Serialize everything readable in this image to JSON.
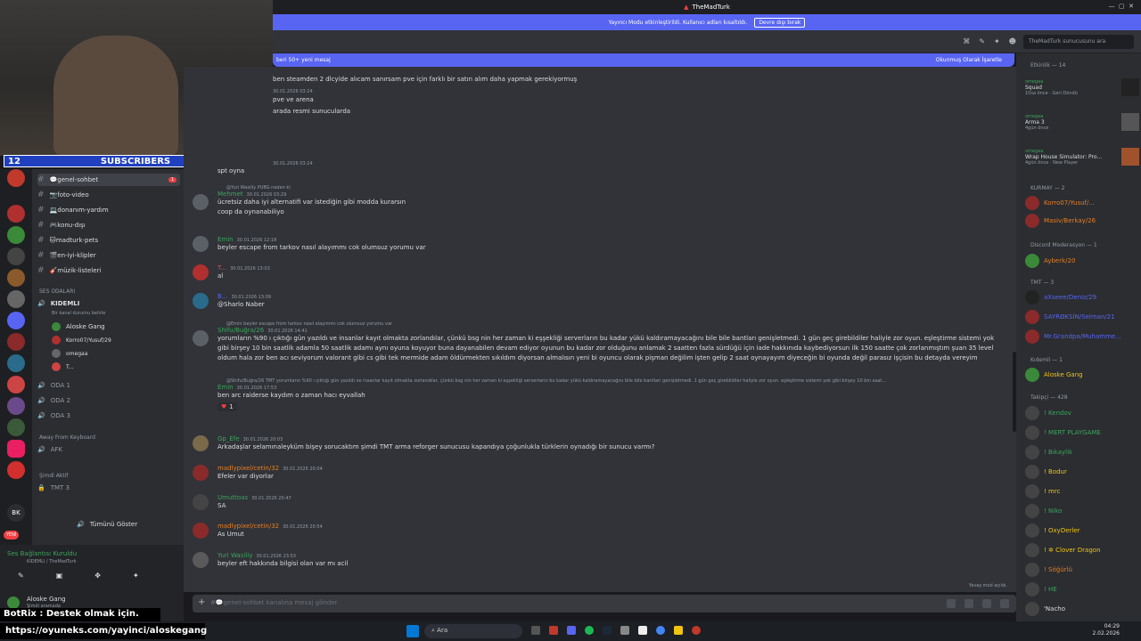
{
  "title": "TheMadTurk",
  "streamer_banner": {
    "text": "Yayıncı Modu etkinleştirildi. Kullanıcı adları kısaltıldı.",
    "button": "Devre dışı bırak"
  },
  "header": {
    "search_placeholder": "TheMadTurk sunucusunu ara"
  },
  "new_messages": {
    "left": "beri 50+ yeni mesaj",
    "right": "Okunmuş Olarak İşaretle"
  },
  "subs": {
    "left": "12",
    "center": "SUBSCRIBERS",
    "right": "10"
  },
  "channels": [
    {
      "name": "💬genel-sohbet",
      "badge": "1"
    },
    {
      "name": "📷foto-video"
    },
    {
      "name": "💻donanım-yardım"
    },
    {
      "name": "🎮konu-dışı"
    },
    {
      "name": "🐱madturk-pets"
    },
    {
      "name": "🎬en-iyi-klipler"
    },
    {
      "name": "🎸müzik-listeleri"
    }
  ],
  "voice_section": "SES ODALARI",
  "voice_channels": [
    {
      "name": "KIDEMLI",
      "sub": "Bir kanal durumu belirle"
    },
    {
      "name": "ODA 1"
    },
    {
      "name": "ODA 2"
    },
    {
      "name": "ODA 3"
    }
  ],
  "voice_users": [
    "Aloske Gang",
    "Korro07/Yusuf/29",
    "omegaa",
    "T..."
  ],
  "away_section": "Away From Keyboard",
  "afk": "AFK",
  "now_active": "Şimdi Aktif",
  "tmt3": "TMT 3",
  "show_all": "Tümünü Göster",
  "new_label": "YENİ",
  "connection": {
    "title": "Ses Bağlantısı Kuruldu",
    "sub": "KIDEMLI / TheMadTurk"
  },
  "user": {
    "name": "Aloske Gang",
    "status": "Şimdi aramada"
  },
  "messages": [
    {
      "author": "",
      "time": "",
      "text": "ben steamden 2 dlcyide alıcam sanırsam pve için farklı bir satın alım daha yapmak gerekiyormuş"
    },
    {
      "author": "",
      "time": "30.01.2026 03:24",
      "text": "pve ve arena"
    },
    {
      "author": "",
      "time": "",
      "text": "arada resmi sunucularda"
    },
    {
      "author": "",
      "time": "30.01.2026 03:24",
      "text": "spt oyna"
    },
    {
      "author": "Mehmet",
      "color": "#3ba55c",
      "time": "30.01.2026 03:29",
      "reply": "@Yuri Wasiliy  PUBG  neden ki",
      "text": "ücretsiz daha iyi alternatifi var istediğin gibi modda kurarsın\ncoop da oynanabiliyo"
    },
    {
      "author": "Emin",
      "color": "#3ba55c",
      "time": "30.01.2026 12:18",
      "text": "beyler escape from tarkov nasıl alayımmı cok olumsuz yorumu var"
    },
    {
      "author": "T...",
      "color": "#f04747",
      "time": "30.01.2026 13:03",
      "text": "al"
    },
    {
      "author": "B...",
      "color": "#5865f2",
      "time": "30.01.2026 13:09",
      "text": "@Sharlo Naber"
    },
    {
      "author": "Shifu/Buğra/26",
      "color": "#3ba55c",
      "time": "30.01.2026 14:41",
      "reply": "@Emin beyler escape from tarkov nasıl alayımmı cok olumsuz yorumu var",
      "text": "yorumların %90 ı çıktığı gün yazıldı ve insanlar kayıt olmakta zorlandılar, çünkü bsg nin her zaman ki eşşekliği serverların bu kadar yükü kaldıramayacağını bile bile bantları genişletmedi. 1 gün geç girebildiler haliyle zor oyun. eşleştirme sistemi yok gibi birşey 10 bin saatlik adamla 50 saatlik adamı aynı oyuna koyuyor buna dayanabilen devam ediyor oyunun bu kadar zor olduğunu anlamak 2 saatten fazla sürdüğü için iade hakkınıda kaybediyorsun ilk 150 saatte çok zorlanmıştım şuan 35 level oldum hala zor ben acı seviyorum valorant gibi cs gibi tek mermide adam öldürmekten sıkıldım diyorsan almalısın yeni bi oyuncu olarak pişman değilim işten gelip 2 saat oynayayım diyeceğin bi oyunda değil parasız işçisin bu detayda vereyim"
    },
    {
      "author": "Emin",
      "color": "#3ba55c",
      "time": "30.01.2026 17:53",
      "reply": "@Shifu/Buğra/26  TMT  yorumların %90 ı çıktığı gün yazıldı ve insanlar kayıt olmakta zorlandılar, çünkü bsg nin her zaman ki eşşekliği serverların bu kadar yükü kaldıramayacağını bile bile bantları genişletmedi. 1 gün geç girebildiler haliyle zor oyun. eşleştirme sistemi yok gibi birşey 10 bin saat...",
      "text": "ben arc raiderse kaydım o zaman hacı eyvallah"
    },
    {
      "author": "Gp_Efe",
      "color": "#3ba55c",
      "time": "30.01.2026 20:03",
      "text": "Arkadaşlar selamınaleyküm bişey sorucaktım şimdi TMT arma reforger sunucusu kapandıya çoğunlukla türklerin oynadığı bir sunucu varmı?"
    },
    {
      "author": "madlypixel/cetin/32",
      "color": "#e67e22",
      "time": "30.01.2026 20:04",
      "text": "Efeler var diyorlar"
    },
    {
      "author": "Umuttoas",
      "color": "#3ba55c",
      "time": "30.01.2026 20:47",
      "text": "SA"
    },
    {
      "author": "madlypixel/cetin/32",
      "color": "#e67e22",
      "time": "30.01.2026 20:54",
      "text": "As Umut"
    },
    {
      "author": "Yuri Wasiliy",
      "color": "#3ba55c",
      "time": "30.01.2026 23:53",
      "text": "beyler eft hakkında bilgisi olan var mı acil"
    }
  ],
  "reaction_count": "1",
  "slow_mode": "Yavaş mod açıldı.",
  "composer_placeholder": "#💬genel-sohbet kanalına mesaj gönder",
  "members_header": "Etkinlik — 14",
  "activities": [
    {
      "name": "omegaa",
      "game": "Squad",
      "sub": "10sa önce · Geri Döndü"
    },
    {
      "name": "omegaa",
      "game": "Arma 3",
      "sub": "4gün önce"
    },
    {
      "name": "omegaa",
      "game": "Wrap House Simulator: Pro...",
      "sub": "4gün önce · New Player"
    }
  ],
  "member_groups": [
    {
      "label": "KURMAY — 2",
      "members": [
        "Korro07/Yusuf/...",
        "Masiv/Berkay/26"
      ]
    },
    {
      "label": "Discord Moderasyon — 1",
      "members": [
        "Ayberk/20"
      ]
    },
    {
      "label": "TMT — 3",
      "members": [
        "aXseee/Deniz/29",
        "SAYRØKSİN/Selman/21",
        "Mr.Grandpa/Muhamme..."
      ]
    },
    {
      "label": "Kıdemli — 1",
      "members": [
        "Aloske Gang"
      ]
    },
    {
      "label": "Takipçi — 428",
      "members": [
        "! Kendov",
        "! MERT PLAYGAME",
        "! Bıkaylik",
        "! Bodur",
        "! mrc",
        "! Niko",
        "! OxyDerler",
        "! ✲ Clover Dragon",
        "! Söğürlü",
        "! HE",
        "'Nacho"
      ]
    }
  ],
  "overlay": {
    "line1": "BotRix : Destek olmak için.",
    "line2": "https://oyuneks.com/yayinci/aloskegang"
  },
  "taskbar": {
    "search": "Ara",
    "time": "04:29",
    "date": "2.02.2026"
  }
}
